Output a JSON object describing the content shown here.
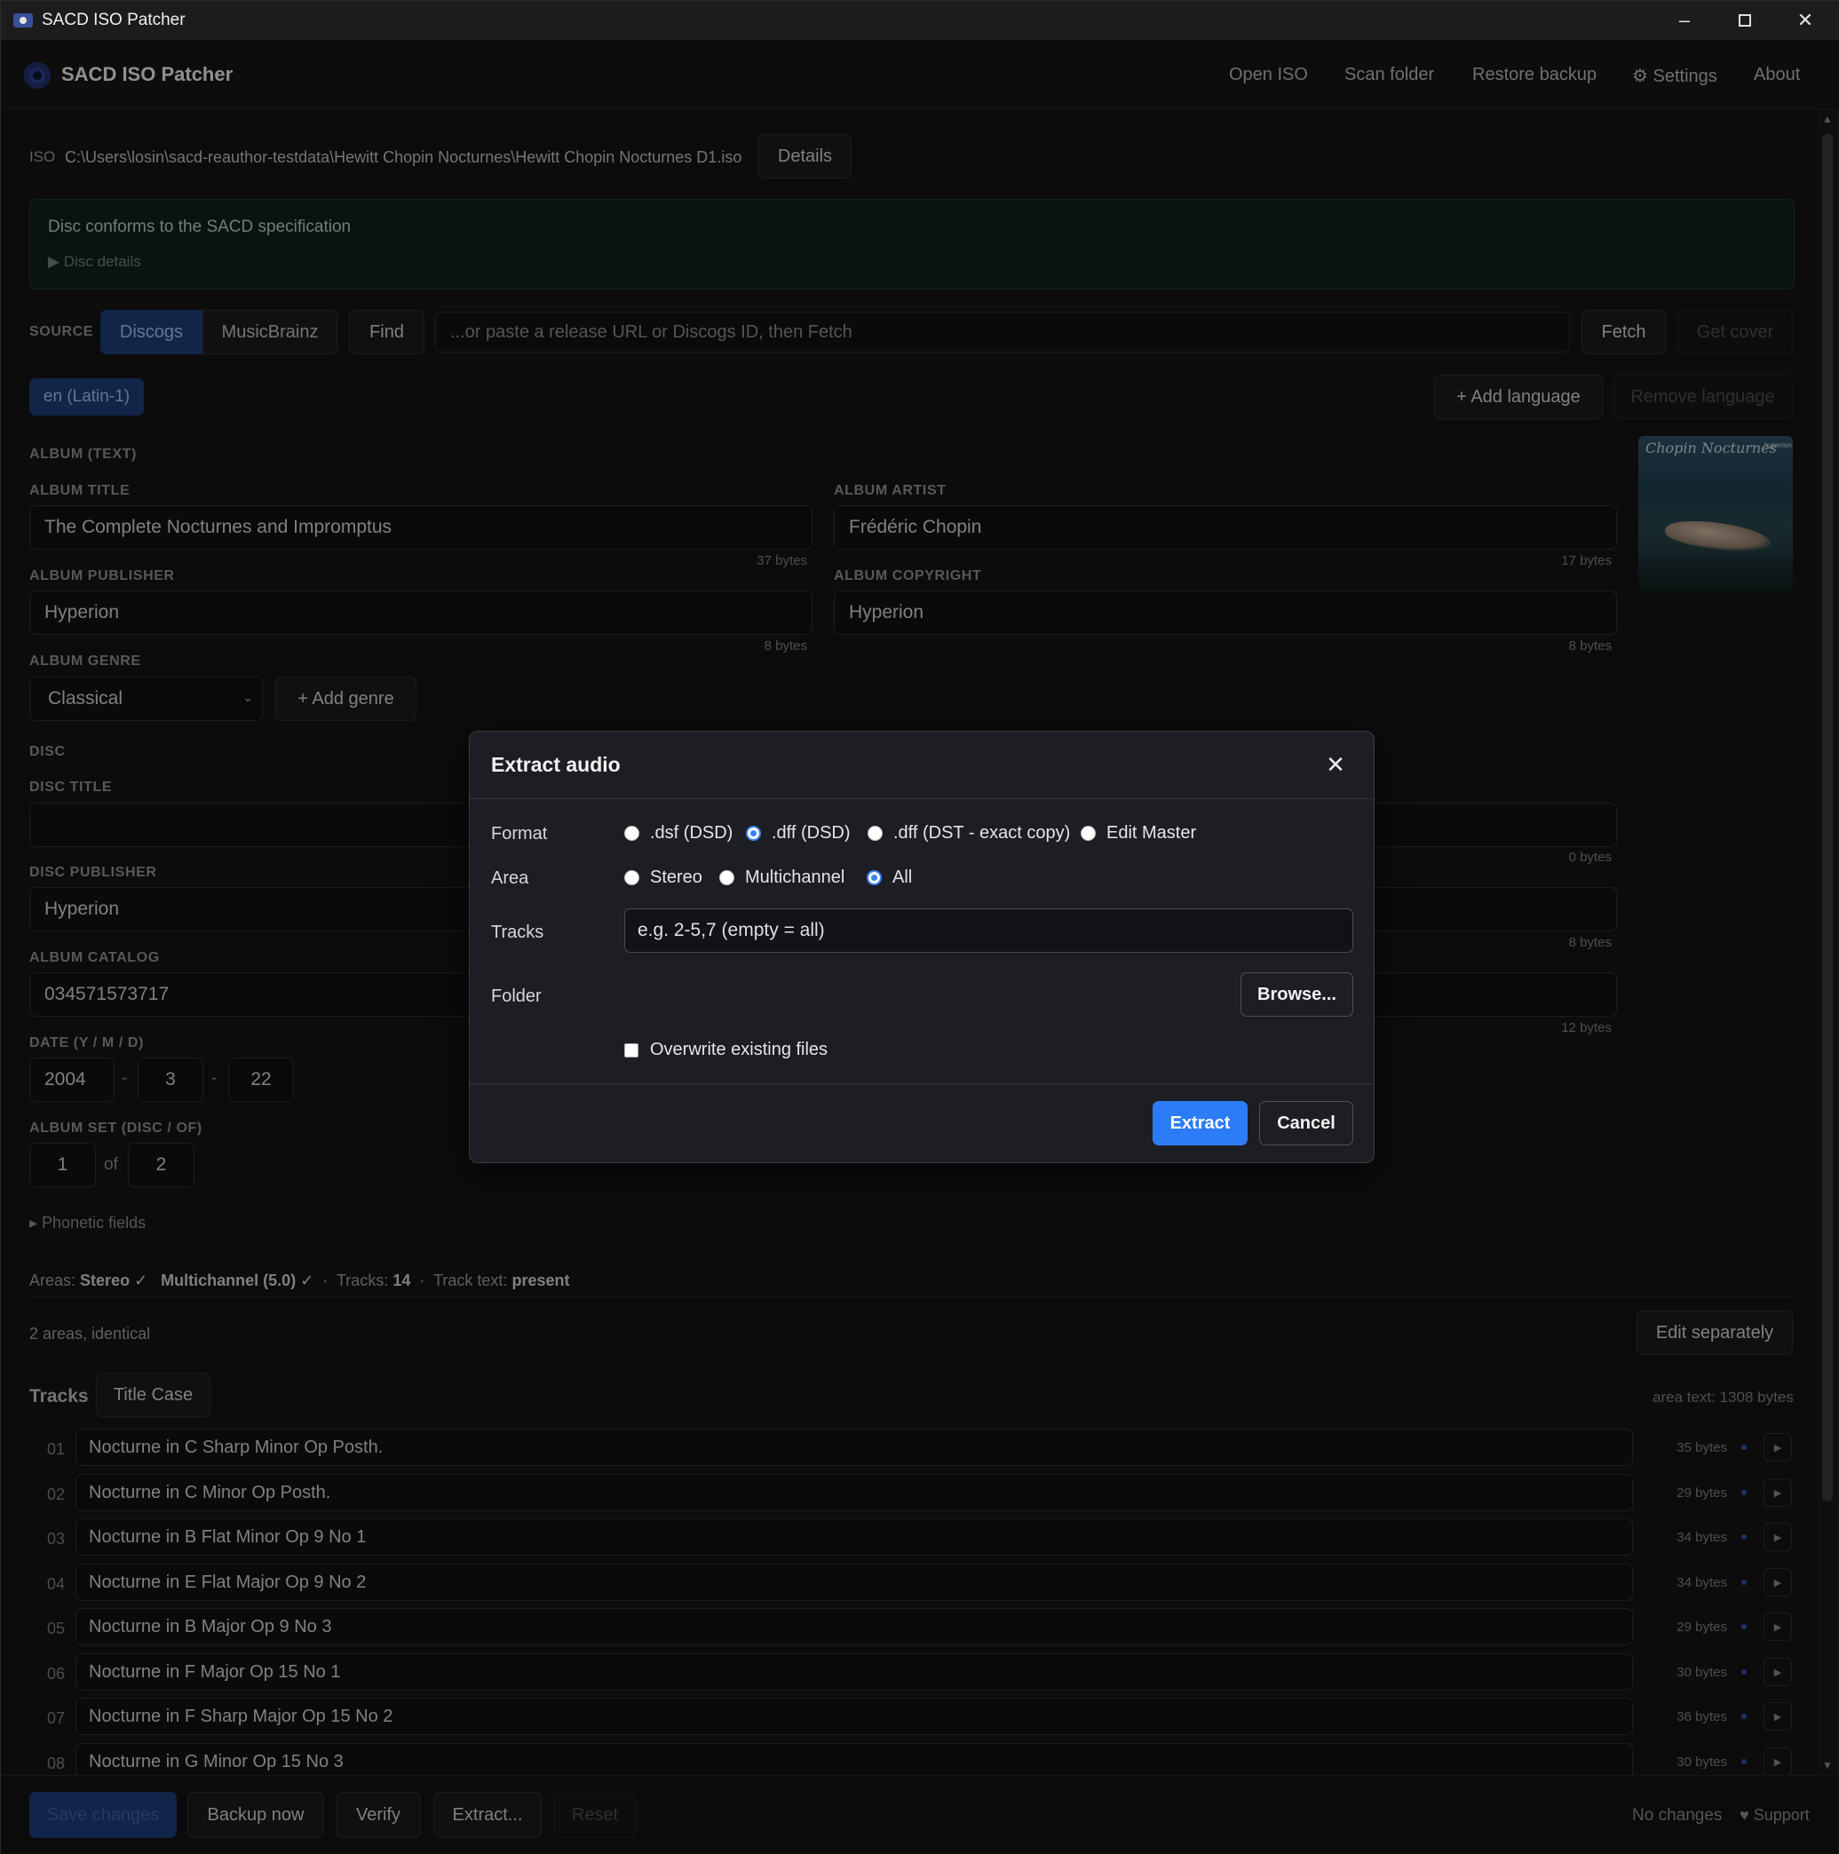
{
  "window": {
    "title": "SACD ISO Patcher"
  },
  "header": {
    "brand": "SACD ISO Patcher",
    "nav": [
      "Open ISO",
      "Scan folder",
      "Restore backup",
      "⚙ Settings",
      "About"
    ]
  },
  "iso": {
    "label": "ISO",
    "path": "C:\\Users\\losin\\sacd-reauthor-testdata\\Hewitt Chopin Nocturnes\\Hewitt Chopin Nocturnes D1.iso",
    "details_button": "Details"
  },
  "conformance": {
    "message": "Disc conforms to the SACD specification",
    "disclosure": "▶ Disc details"
  },
  "source": {
    "label": "SOURCE",
    "tabs": [
      "Discogs",
      "MusicBrainz"
    ],
    "find_button": "Find",
    "url_placeholder": "...or paste a release URL or Discogs ID, then Fetch",
    "fetch_button": "Fetch",
    "cover_button": "Get cover"
  },
  "language": {
    "current": "en (Latin-1)",
    "add_button": "+ Add language",
    "remove_button": "Remove language"
  },
  "album": {
    "section": "ALBUM (TEXT)",
    "title": {
      "label": "ALBUM TITLE",
      "value": "The Complete Nocturnes and Impromptus",
      "bytes": "37 bytes"
    },
    "artist": {
      "label": "ALBUM ARTIST",
      "value": "Frédéric Chopin",
      "bytes": "17 bytes"
    },
    "publisher": {
      "label": "ALBUM PUBLISHER",
      "value": "Hyperion",
      "bytes": "8 bytes"
    },
    "copyright": {
      "label": "ALBUM COPYRIGHT",
      "value": "Hyperion",
      "bytes": "8 bytes"
    },
    "genre": {
      "label": "ALBUM GENRE",
      "value": "Classical",
      "add_button": "+ Add genre"
    },
    "cover": {
      "script_title": "Chopin Nocturnes",
      "label_mark": "hyperion"
    }
  },
  "disc": {
    "section": "DISC",
    "title": {
      "label": "DISC TITLE",
      "value": "",
      "bytes": "0 bytes"
    },
    "publisher": {
      "label": "DISC PUBLISHER",
      "value": "Hyperion",
      "bytes": "8 bytes"
    },
    "catalog": {
      "label": "ALBUM CATALOG",
      "value": "034571573717",
      "bytes": "12 bytes"
    },
    "date": {
      "label": "DATE (Y / M / D)",
      "year": "2004",
      "month": "3",
      "day": "22",
      "sep": "-"
    },
    "set": {
      "label": "ALBUM SET (DISC / OF)",
      "disc": "1",
      "of_label": "of",
      "total": "2"
    },
    "phonetic": "▸ Phonetic fields"
  },
  "summary": {
    "areas_label": "Areas:",
    "stereo": "Stereo ✓",
    "multichannel": "Multichannel (5.0) ✓",
    "dot1": "·",
    "tracks_label": "Tracks:",
    "tracks_count": "14",
    "dot2": "·",
    "track_text_label": "Track text:",
    "track_text_value": "present",
    "areas_note": "2 areas, identical",
    "edit_separately": "Edit separately"
  },
  "tracks": {
    "heading": "Tracks",
    "title_case_button": "Title Case",
    "area_text": "area text: 1308 bytes",
    "rows": [
      {
        "num": "01",
        "title": "Nocturne in C Sharp Minor Op Posth.",
        "bytes": "35 bytes"
      },
      {
        "num": "02",
        "title": "Nocturne in C Minor Op Posth.",
        "bytes": "29 bytes"
      },
      {
        "num": "03",
        "title": "Nocturne in B Flat Minor Op 9 No 1",
        "bytes": "34 bytes"
      },
      {
        "num": "04",
        "title": "Nocturne in E Flat Major Op 9 No 2",
        "bytes": "34 bytes"
      },
      {
        "num": "05",
        "title": "Nocturne in B Major Op 9 No 3",
        "bytes": "29 bytes"
      },
      {
        "num": "06",
        "title": "Nocturne in F Major Op 15 No 1",
        "bytes": "30 bytes"
      },
      {
        "num": "07",
        "title": "Nocturne in F Sharp Major Op 15 No 2",
        "bytes": "36 bytes"
      },
      {
        "num": "08",
        "title": "Nocturne in G Minor Op 15 No 3",
        "bytes": "30 bytes"
      }
    ]
  },
  "footer": {
    "save": "Save changes",
    "backup": "Backup now",
    "verify": "Verify",
    "extract": "Extract...",
    "reset": "Reset",
    "status": "No changes",
    "support": "♥ Support"
  },
  "dialog": {
    "title": "Extract audio",
    "format_label": "Format",
    "formats": [
      ".dsf (DSD)",
      ".dff (DSD)",
      ".dff (DST - exact copy)",
      "Edit Master"
    ],
    "format_selected": ".dff (DSD)",
    "area_label": "Area",
    "areas": [
      "Stereo",
      "Multichannel",
      "All"
    ],
    "area_selected": "All",
    "tracks_label": "Tracks",
    "tracks_placeholder": "e.g. 2-5,7 (empty = all)",
    "folder_label": "Folder",
    "browse_button": "Browse...",
    "overwrite_label": "Overwrite existing files",
    "overwrite_checked": false,
    "extract_button": "Extract",
    "cancel_button": "Cancel"
  },
  "colors": {
    "accent": "#2b7cf6",
    "tab_active": "#1e3a75",
    "conform_bg": "#13201a"
  }
}
